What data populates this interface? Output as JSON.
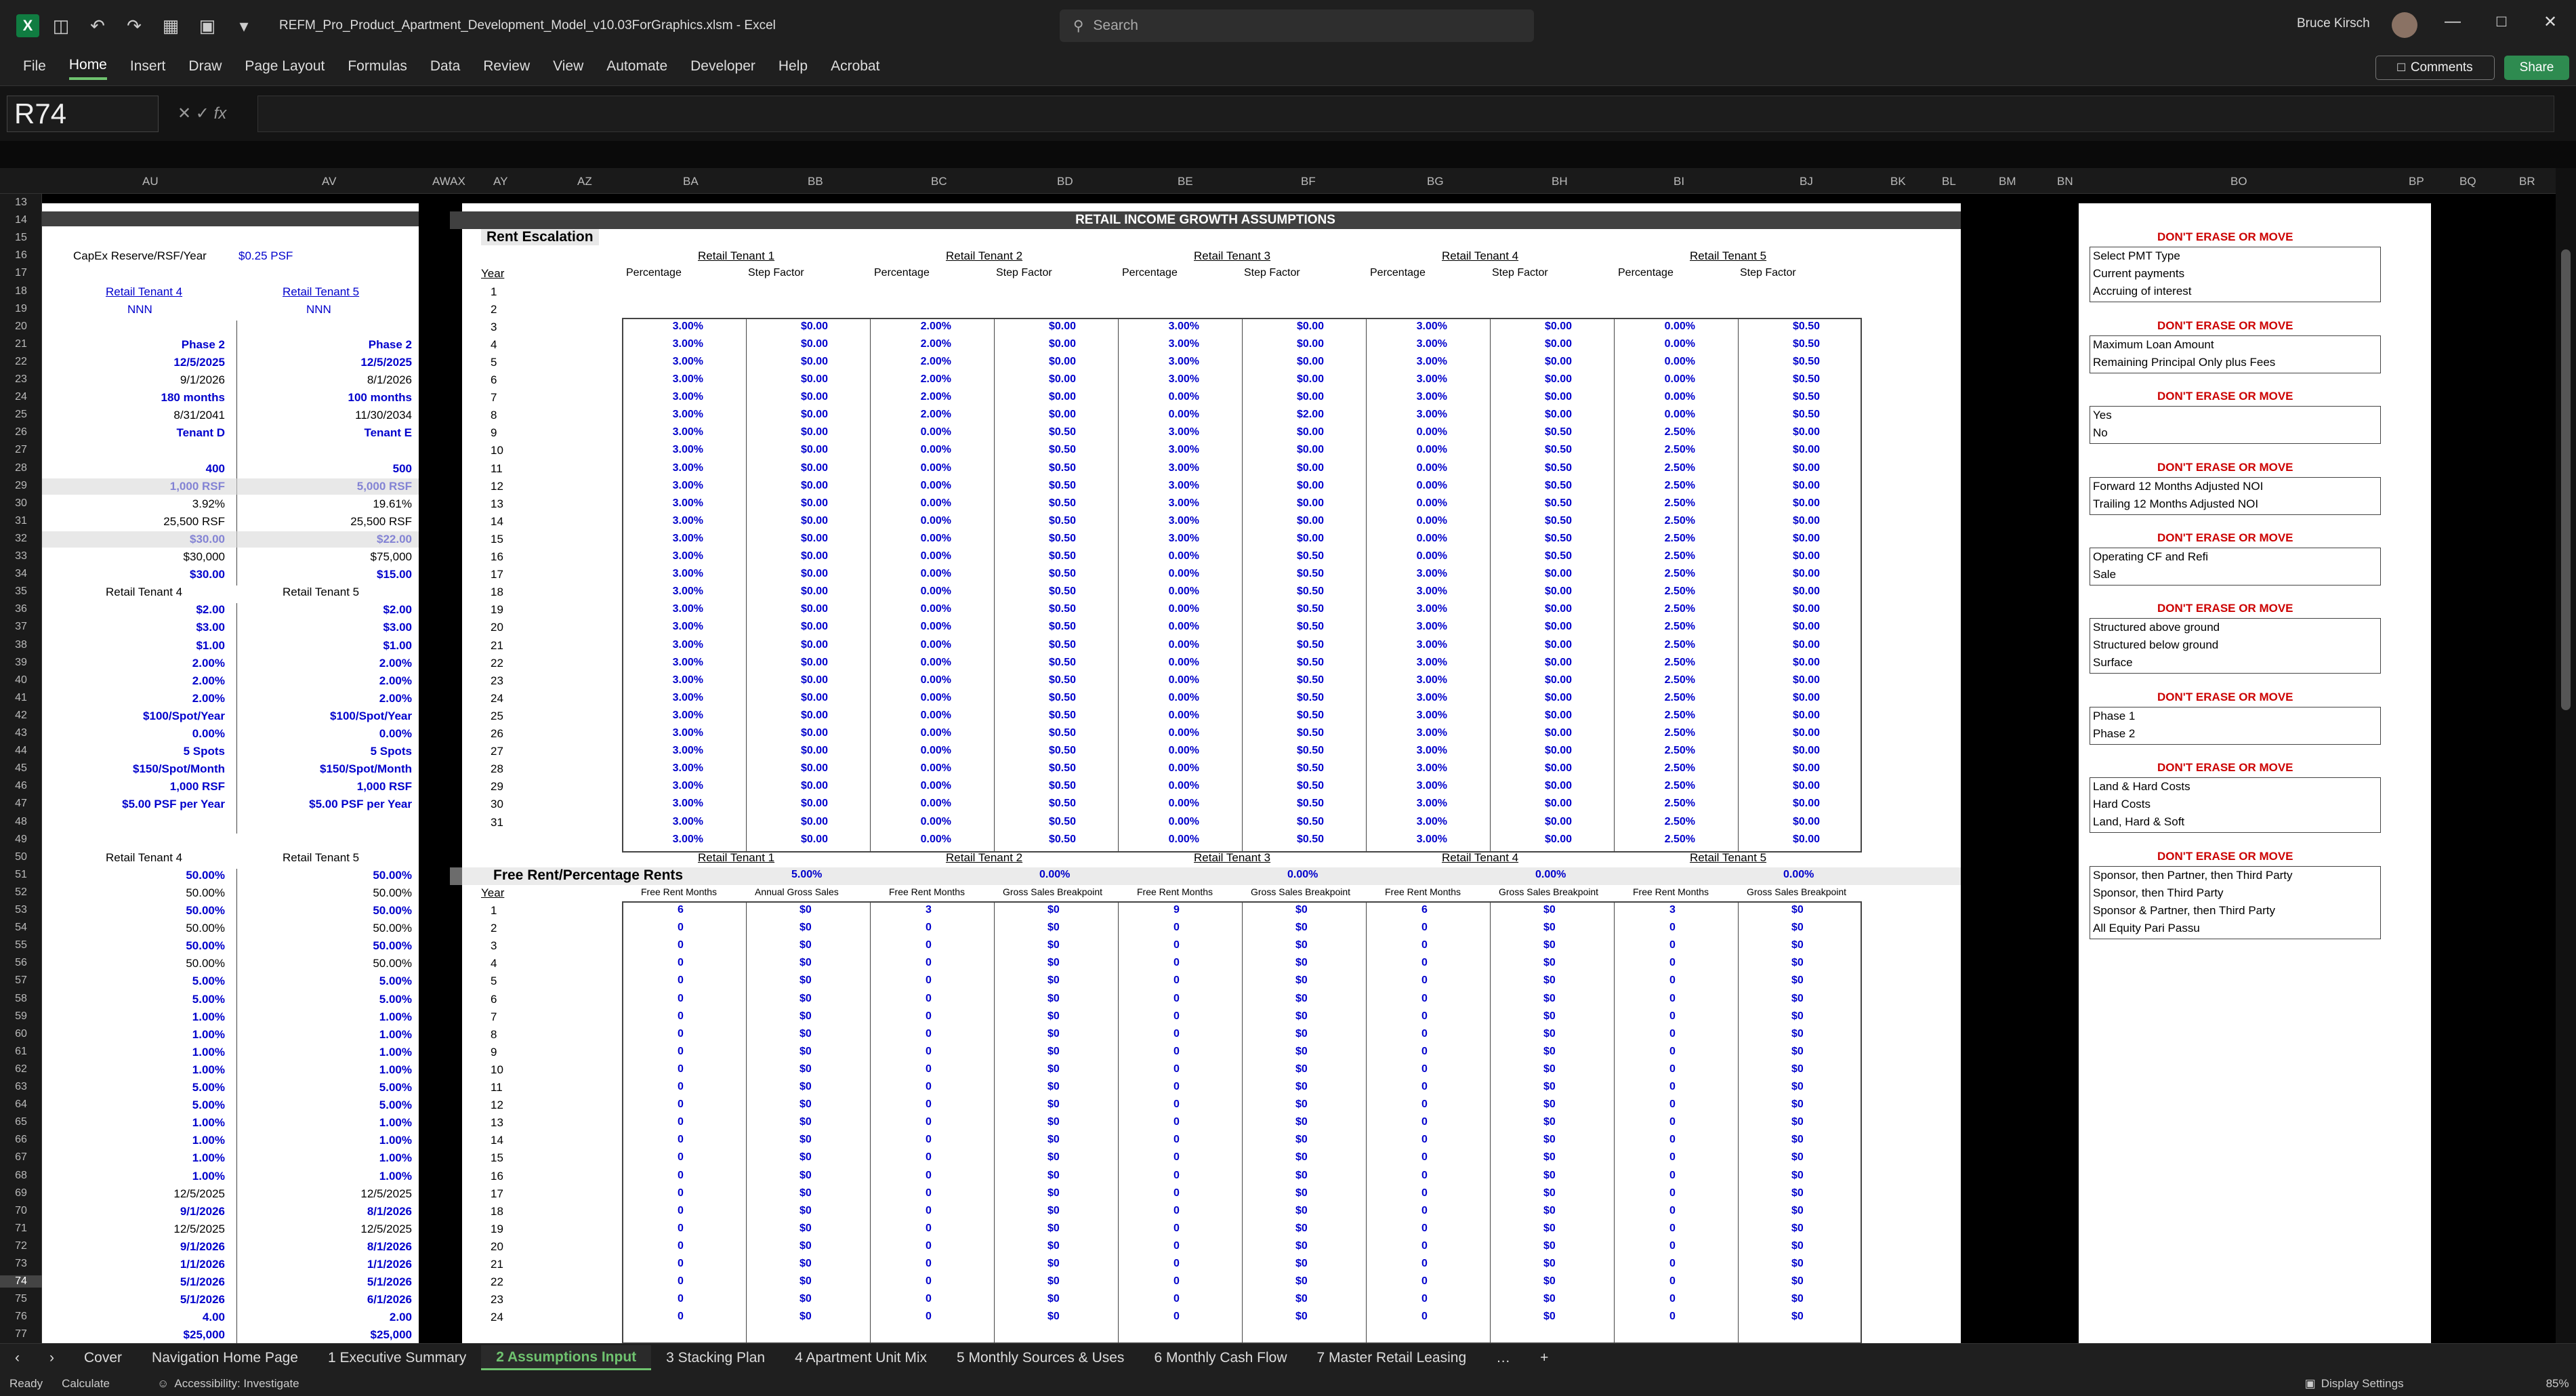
{
  "window": {
    "title": "REFM_Pro_Product_Apartment_Development_Model_v10.03ForGraphics.xlsm  -  Excel",
    "search_placeholder": "Search",
    "user": "Bruce Kirsch"
  },
  "ribbon": {
    "tabs": [
      "File",
      "Home",
      "Insert",
      "Draw",
      "Page Layout",
      "Formulas",
      "Data",
      "Review",
      "View",
      "Automate",
      "Developer",
      "Help",
      "Acrobat"
    ],
    "active": "Home",
    "comments": "Comments",
    "share": "Share"
  },
  "formula_bar": {
    "name_box": "R74",
    "fx": "fx",
    "formula": ""
  },
  "columns": [
    "AU",
    "AV",
    "AWAX",
    "AY",
    "AZ",
    "BA",
    "BB",
    "BC",
    "BD",
    "BE",
    "BF",
    "BG",
    "BH",
    "BI",
    "BJ",
    "BK",
    "BL",
    "BM",
    "BN",
    "BO",
    "BP",
    "BQ",
    "BR"
  ],
  "rows": [
    "13",
    "14",
    "15",
    "16",
    "17",
    "18",
    "19",
    "20",
    "21",
    "22",
    "23",
    "24",
    "25",
    "26",
    "27",
    "28",
    "29",
    "30",
    "31",
    "32",
    "33",
    "34",
    "35",
    "36",
    "37",
    "38",
    "39",
    "40",
    "41",
    "42",
    "43",
    "44",
    "45",
    "46",
    "47",
    "48",
    "49",
    "50",
    "51",
    "52",
    "53",
    "54",
    "55",
    "56",
    "57",
    "58",
    "59",
    "60",
    "61",
    "62",
    "63",
    "64",
    "65",
    "66",
    "67",
    "68",
    "69",
    "70",
    "71",
    "72",
    "73",
    "74",
    "75",
    "76",
    "77"
  ],
  "left_panel": {
    "capex_label": "CapEx Reserve/RSF/Year",
    "capex_value": "$0.25 PSF",
    "t4_link": "Retail Tenant 4",
    "t5_link": "Retail Tenant 5",
    "t4_lease": "NNN",
    "t5_lease": "NNN",
    "t4": [
      "Phase 2",
      "12/5/2025",
      "9/1/2026",
      "180 months",
      "8/31/2041",
      "Tenant D",
      "",
      "400",
      "1,000 RSF",
      "3.92%",
      "25,500 RSF",
      "$30.00",
      "$30,000",
      "$30.00"
    ],
    "t5": [
      "Phase 2",
      "12/5/2025",
      "8/1/2026",
      "100 months",
      "11/30/2034",
      "Tenant E",
      "",
      "500",
      "5,000 RSF",
      "19.61%",
      "25,500 RSF",
      "$22.00",
      "$75,000",
      "$15.00"
    ],
    "t4_b_title": "Retail Tenant 4",
    "t5_b_title": "Retail Tenant 5",
    "t4_b": [
      "$2.00",
      "$3.00",
      "$1.00",
      "2.00%",
      "2.00%",
      "2.00%",
      "$100/Spot/Year",
      "0.00%",
      "5 Spots",
      "$150/Spot/Month",
      "1,000 RSF",
      "$5.00 PSF per Year"
    ],
    "t5_b": [
      "$2.00",
      "$3.00",
      "$1.00",
      "2.00%",
      "2.00%",
      "2.00%",
      "$100/Spot/Year",
      "0.00%",
      "5 Spots",
      "$150/Spot/Month",
      "1,000 RSF",
      "$5.00 PSF per Year"
    ],
    "t4_c_title": "Retail Tenant 4",
    "t5_c_title": "Retail Tenant 5",
    "t4_c": [
      "50.00%",
      "50.00%",
      "50.00%",
      "50.00%",
      "50.00%",
      "50.00%",
      "5.00%",
      "5.00%",
      "1.00%",
      "1.00%",
      "1.00%",
      "1.00%",
      "5.00%",
      "5.00%",
      "1.00%",
      "1.00%",
      "1.00%",
      "1.00%",
      "12/5/2025",
      "9/1/2026",
      "12/5/2025",
      "9/1/2026",
      "1/1/2026",
      "5/1/2026",
      "5/1/2026",
      "4.00",
      "$25,000"
    ],
    "t5_c": [
      "50.00%",
      "50.00%",
      "50.00%",
      "50.00%",
      "50.00%",
      "50.00%",
      "5.00%",
      "5.00%",
      "1.00%",
      "1.00%",
      "1.00%",
      "1.00%",
      "5.00%",
      "5.00%",
      "1.00%",
      "1.00%",
      "1.00%",
      "1.00%",
      "12/5/2025",
      "8/1/2026",
      "12/5/2025",
      "8/1/2026",
      "1/1/2026",
      "5/1/2026",
      "6/1/2026",
      "2.00",
      "$25,000"
    ]
  },
  "growth": {
    "title": "RETAIL INCOME GROWTH ASSUMPTIONS",
    "rent_escalation": "Rent Escalation",
    "year_label": "Year",
    "tenants": [
      "Retail Tenant 1",
      "Retail Tenant 2",
      "Retail Tenant 3",
      "Retail Tenant 4",
      "Retail Tenant 5"
    ],
    "sub_pct": "Percentage",
    "sub_step": "Step Factor",
    "years": [
      "1",
      "2",
      "3",
      "4",
      "5",
      "6",
      "7",
      "8",
      "9",
      "10",
      "11",
      "12",
      "13",
      "14",
      "15",
      "16",
      "17",
      "18",
      "19",
      "20",
      "21",
      "22",
      "23",
      "24",
      "25",
      "26",
      "27",
      "28",
      "29",
      "30",
      "31"
    ],
    "t1_pct": [
      "3.00%",
      "3.00%",
      "3.00%",
      "3.00%",
      "3.00%",
      "3.00%",
      "3.00%",
      "3.00%",
      "3.00%",
      "3.00%",
      "3.00%",
      "3.00%",
      "3.00%",
      "3.00%",
      "3.00%",
      "3.00%",
      "3.00%",
      "3.00%",
      "3.00%",
      "3.00%",
      "3.00%",
      "3.00%",
      "3.00%",
      "3.00%",
      "3.00%",
      "3.00%",
      "3.00%",
      "3.00%",
      "3.00%",
      "3.00%"
    ],
    "t1_step": [
      "$0.00",
      "$0.00",
      "$0.00",
      "$0.00",
      "$0.00",
      "$0.00",
      "$0.00",
      "$0.00",
      "$0.00",
      "$0.00",
      "$0.00",
      "$0.00",
      "$0.00",
      "$0.00",
      "$0.00",
      "$0.00",
      "$0.00",
      "$0.00",
      "$0.00",
      "$0.00",
      "$0.00",
      "$0.00",
      "$0.00",
      "$0.00",
      "$0.00",
      "$0.00",
      "$0.00",
      "$0.00",
      "$0.00",
      "$0.00"
    ],
    "t2_pct": [
      "2.00%",
      "2.00%",
      "2.00%",
      "2.00%",
      "2.00%",
      "2.00%",
      "0.00%",
      "0.00%",
      "0.00%",
      "0.00%",
      "0.00%",
      "0.00%",
      "0.00%",
      "0.00%",
      "0.00%",
      "0.00%",
      "0.00%",
      "0.00%",
      "0.00%",
      "0.00%",
      "0.00%",
      "0.00%",
      "0.00%",
      "0.00%",
      "0.00%",
      "0.00%",
      "0.00%",
      "0.00%",
      "0.00%",
      "0.00%"
    ],
    "t2_step": [
      "$0.00",
      "$0.00",
      "$0.00",
      "$0.00",
      "$0.00",
      "$0.00",
      "$0.50",
      "$0.50",
      "$0.50",
      "$0.50",
      "$0.50",
      "$0.50",
      "$0.50",
      "$0.50",
      "$0.50",
      "$0.50",
      "$0.50",
      "$0.50",
      "$0.50",
      "$0.50",
      "$0.50",
      "$0.50",
      "$0.50",
      "$0.50",
      "$0.50",
      "$0.50",
      "$0.50",
      "$0.50",
      "$0.50",
      "$0.50"
    ],
    "t3_pct": [
      "3.00%",
      "3.00%",
      "3.00%",
      "3.00%",
      "0.00%",
      "0.00%",
      "3.00%",
      "3.00%",
      "3.00%",
      "3.00%",
      "3.00%",
      "3.00%",
      "3.00%",
      "0.00%",
      "0.00%",
      "0.00%",
      "0.00%",
      "0.00%",
      "0.00%",
      "0.00%",
      "0.00%",
      "0.00%",
      "0.00%",
      "0.00%",
      "0.00%",
      "0.00%",
      "0.00%",
      "0.00%",
      "0.00%",
      "0.00%"
    ],
    "t3_step": [
      "$0.00",
      "$0.00",
      "$0.00",
      "$0.00",
      "$0.00",
      "$2.00",
      "$0.00",
      "$0.00",
      "$0.00",
      "$0.00",
      "$0.00",
      "$0.00",
      "$0.00",
      "$0.50",
      "$0.50",
      "$0.50",
      "$0.50",
      "$0.50",
      "$0.50",
      "$0.50",
      "$0.50",
      "$0.50",
      "$0.50",
      "$0.50",
      "$0.50",
      "$0.50",
      "$0.50",
      "$0.50",
      "$0.50",
      "$0.50"
    ],
    "t4_pct": [
      "3.00%",
      "3.00%",
      "3.00%",
      "3.00%",
      "3.00%",
      "3.00%",
      "0.00%",
      "0.00%",
      "0.00%",
      "0.00%",
      "0.00%",
      "0.00%",
      "0.00%",
      "0.00%",
      "3.00%",
      "3.00%",
      "3.00%",
      "3.00%",
      "3.00%",
      "3.00%",
      "3.00%",
      "3.00%",
      "3.00%",
      "3.00%",
      "3.00%",
      "3.00%",
      "3.00%",
      "3.00%",
      "3.00%",
      "3.00%"
    ],
    "t4_step": [
      "$0.00",
      "$0.00",
      "$0.00",
      "$0.00",
      "$0.00",
      "$0.00",
      "$0.50",
      "$0.50",
      "$0.50",
      "$0.50",
      "$0.50",
      "$0.50",
      "$0.50",
      "$0.50",
      "$0.00",
      "$0.00",
      "$0.00",
      "$0.00",
      "$0.00",
      "$0.00",
      "$0.00",
      "$0.00",
      "$0.00",
      "$0.00",
      "$0.00",
      "$0.00",
      "$0.00",
      "$0.00",
      "$0.00",
      "$0.00"
    ],
    "t5_pct": [
      "0.00%",
      "0.00%",
      "0.00%",
      "0.00%",
      "0.00%",
      "0.00%",
      "2.50%",
      "2.50%",
      "2.50%",
      "2.50%",
      "2.50%",
      "2.50%",
      "2.50%",
      "2.50%",
      "2.50%",
      "2.50%",
      "2.50%",
      "2.50%",
      "2.50%",
      "2.50%",
      "2.50%",
      "2.50%",
      "2.50%",
      "2.50%",
      "2.50%",
      "2.50%",
      "2.50%",
      "2.50%",
      "2.50%",
      "2.50%"
    ],
    "t5_step": [
      "$0.50",
      "$0.50",
      "$0.50",
      "$0.50",
      "$0.50",
      "$0.50",
      "$0.00",
      "$0.00",
      "$0.00",
      "$0.00",
      "$0.00",
      "$0.00",
      "$0.00",
      "$0.00",
      "$0.00",
      "$0.00",
      "$0.00",
      "$0.00",
      "$0.00",
      "$0.00",
      "$0.00",
      "$0.00",
      "$0.00",
      "$0.00",
      "$0.00",
      "$0.00",
      "$0.00",
      "$0.00",
      "$0.00",
      "$0.00"
    ],
    "free_rent_title": "Free Rent/Percentage Rents",
    "pct_rents": [
      "5.00%",
      "0.00%",
      "0.00%",
      "0.00%",
      "0.00%"
    ],
    "sub_frm": "Free Rent Months",
    "sub_ags": "Annual Gross Sales",
    "sub_gsb": "Gross Sales Breakpoint",
    "fr_years": [
      "1",
      "2",
      "3",
      "4",
      "5",
      "6",
      "7",
      "8",
      "9",
      "10",
      "11",
      "12",
      "13",
      "14",
      "15",
      "16",
      "17",
      "18",
      "19",
      "20",
      "21",
      "22",
      "23",
      "24"
    ],
    "fr_first": [
      "6",
      "3",
      "9",
      "6",
      "3"
    ],
    "fr_zero": "0",
    "fr_dollar": "$0"
  },
  "lists": {
    "warning": "DON'T ERASE OR MOVE",
    "boxes": [
      [
        "Select PMT Type",
        "Current payments",
        "Accruing of interest"
      ],
      [
        "Maximum Loan Amount",
        "Remaining Principal Only plus Fees"
      ],
      [
        "Yes",
        "No"
      ],
      [
        "Forward 12 Months Adjusted NOI",
        "Trailing 12 Months Adjusted NOI"
      ],
      [
        "Operating CF and Refi",
        "Sale"
      ],
      [
        "Structured above ground",
        "Structured below ground",
        "Surface"
      ],
      [
        "Phase 1",
        "Phase 2"
      ],
      [
        "Land & Hard Costs",
        "Hard Costs",
        "Land, Hard & Soft"
      ],
      [
        "Sponsor, then Partner, then Third Party",
        "Sponsor, then Third Party",
        "Sponsor & Partner, then Third Party",
        "All Equity Pari Passu"
      ]
    ]
  },
  "sheet_tabs": [
    "Cover",
    "Navigation Home Page",
    "1 Executive Summary",
    "2 Assumptions Input",
    "3 Stacking Plan",
    "4 Apartment Unit Mix",
    "5 Monthly Sources & Uses",
    "6 Monthly Cash Flow",
    "7 Master Retail Leasing"
  ],
  "active_sheet": "2 Assumptions Input",
  "status": {
    "ready": "Ready",
    "calculate": "Calculate",
    "accessibility": "Accessibility: Investigate",
    "display": "Display Settings",
    "zoom": "85%"
  }
}
